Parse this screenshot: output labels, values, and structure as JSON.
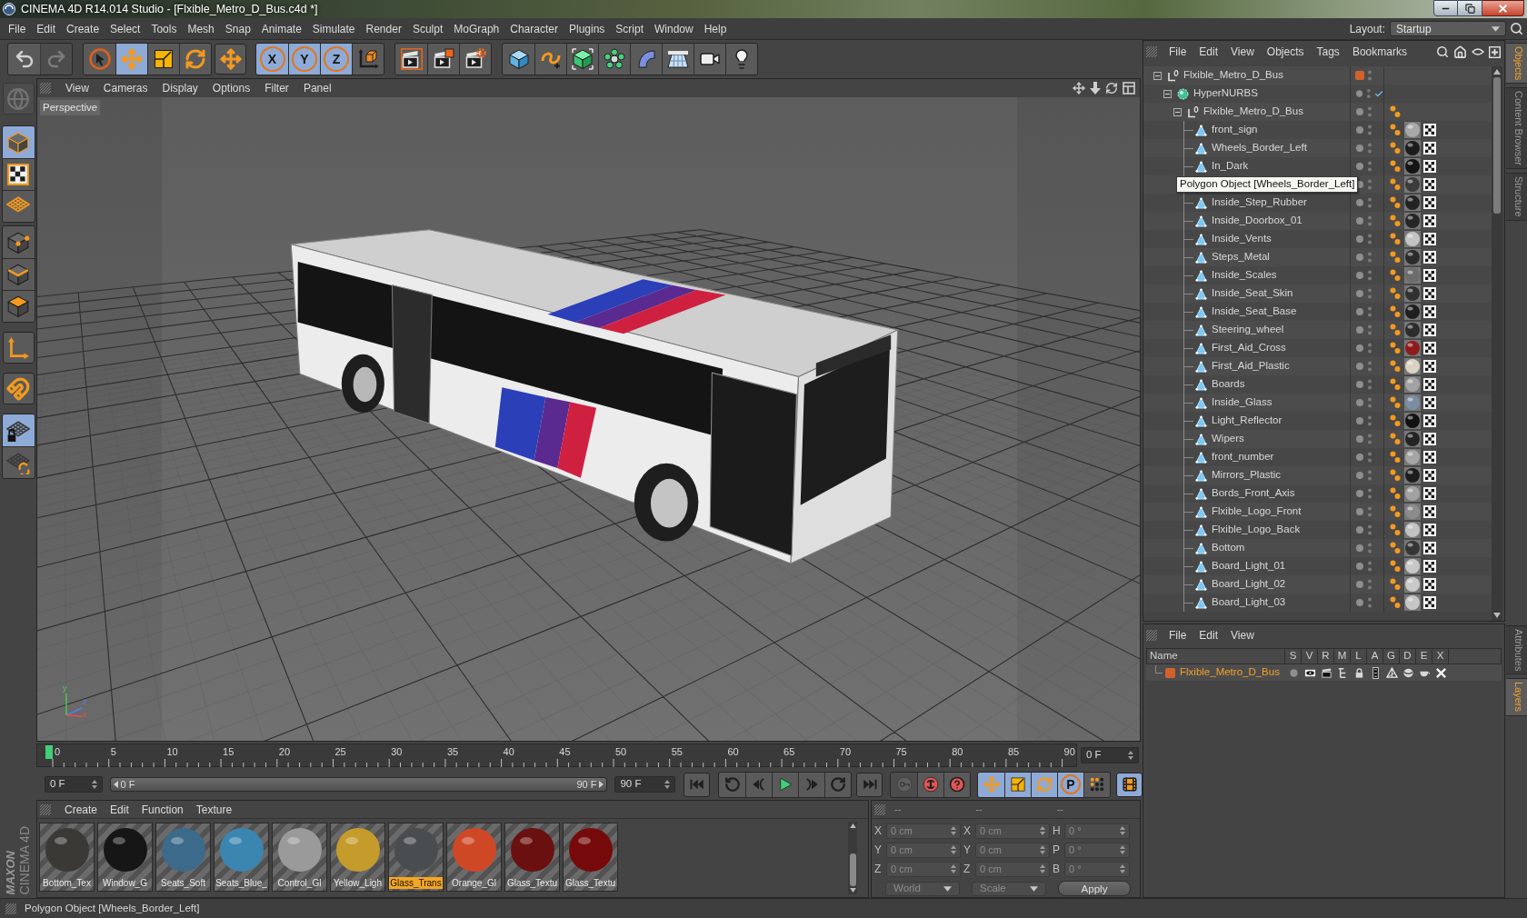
{
  "window": {
    "title": "CINEMA 4D R14.014 Studio - [Flxible_Metro_D_Bus.c4d *]"
  },
  "menu": [
    "File",
    "Edit",
    "Create",
    "Select",
    "Tools",
    "Mesh",
    "Snap",
    "Animate",
    "Simulate",
    "Render",
    "Sculpt",
    "MoGraph",
    "Character",
    "Plugins",
    "Script",
    "Window",
    "Help"
  ],
  "layout": {
    "label": "Layout:",
    "value": "Startup"
  },
  "toolbar": [
    [
      {
        "kind": "undo",
        "selected": false,
        "disabled": false
      },
      {
        "kind": "redo",
        "selected": false,
        "disabled": true
      }
    ],
    [
      {
        "kind": "live-select",
        "selected": false,
        "disabled": false
      },
      {
        "kind": "move",
        "selected": true,
        "disabled": false
      },
      {
        "kind": "scale",
        "selected": false,
        "disabled": false
      },
      {
        "kind": "rotate",
        "selected": false,
        "disabled": false
      }
    ],
    [
      {
        "kind": "recent-tool",
        "selected": false,
        "disabled": false
      }
    ],
    [
      {
        "kind": "axis",
        "label": "X",
        "selected": true,
        "disabled": false
      },
      {
        "kind": "axis",
        "label": "Y",
        "selected": true,
        "disabled": false
      },
      {
        "kind": "axis",
        "label": "Z",
        "selected": true,
        "disabled": false
      },
      {
        "kind": "coord-system",
        "selected": false,
        "disabled": false
      }
    ],
    [
      {
        "kind": "render-view",
        "selected": false,
        "disabled": false
      },
      {
        "kind": "render-picture",
        "selected": false,
        "disabled": false
      },
      {
        "kind": "render-settings",
        "selected": false,
        "disabled": false
      }
    ],
    [
      {
        "kind": "cube",
        "selected": false,
        "disabled": false
      },
      {
        "kind": "spline",
        "selected": false,
        "disabled": false
      },
      {
        "kind": "nurbs",
        "selected": false,
        "disabled": false
      },
      {
        "kind": "cloner",
        "selected": false,
        "disabled": false
      },
      {
        "kind": "deformer",
        "selected": false,
        "disabled": false
      },
      {
        "kind": "floor",
        "selected": false,
        "disabled": false
      },
      {
        "kind": "camera",
        "selected": false,
        "disabled": false
      },
      {
        "kind": "light",
        "selected": false,
        "disabled": false
      }
    ]
  ],
  "modes": [
    [
      {
        "kind": "make-editable",
        "selected": false,
        "disabled": true
      }
    ],
    [
      {
        "kind": "model",
        "selected": true,
        "disabled": false
      },
      {
        "kind": "texture",
        "selected": false,
        "disabled": false
      },
      {
        "kind": "workplane",
        "selected": false,
        "disabled": false
      }
    ],
    [
      {
        "kind": "points",
        "selected": false,
        "disabled": false
      },
      {
        "kind": "edges",
        "selected": false,
        "disabled": false
      },
      {
        "kind": "polygons",
        "selected": false,
        "disabled": false
      }
    ],
    [
      {
        "kind": "axis-mode",
        "selected": false,
        "disabled": false
      }
    ],
    [
      {
        "kind": "snap",
        "selected": false,
        "disabled": false
      }
    ],
    [
      {
        "kind": "lock-workplane",
        "selected": true,
        "disabled": false
      },
      {
        "kind": "planar-workplane",
        "selected": false,
        "disabled": false
      }
    ]
  ],
  "viewport": {
    "menu": [
      "View",
      "Cameras",
      "Display",
      "Options",
      "Filter",
      "Panel"
    ],
    "nav": [
      {
        "kind": "move"
      },
      {
        "kind": "zoom"
      },
      {
        "kind": "rotate"
      },
      {
        "kind": "layout"
      }
    ],
    "label": "Perspective",
    "axis_labels": [
      "y",
      "z",
      "x"
    ]
  },
  "timeline": {
    "ticks": [
      "0",
      "5",
      "10",
      "15",
      "20",
      "25",
      "30",
      "35",
      "40",
      "45",
      "50",
      "55",
      "60",
      "65",
      "70",
      "75",
      "80",
      "85",
      "90"
    ],
    "playhead": {
      "level": 0
    },
    "current_frame": "0 F"
  },
  "playback": {
    "start": "0 F",
    "range": {
      "start": "0 F",
      "end": "90 F",
      "level": 1
    },
    "end": "90 F",
    "controls": [
      [
        {
          "kind": "go-start",
          "selected": false,
          "disabled": false
        }
      ],
      [
        {
          "kind": "prev-key",
          "selected": false,
          "disabled": false
        },
        {
          "kind": "prev-frame",
          "selected": false,
          "disabled": false
        },
        {
          "kind": "play",
          "selected": false,
          "disabled": false
        },
        {
          "kind": "next-frame",
          "selected": false,
          "disabled": false
        },
        {
          "kind": "next-key",
          "selected": false,
          "disabled": false
        }
      ],
      [
        {
          "kind": "go-end",
          "selected": false,
          "disabled": false
        }
      ],
      [
        {
          "kind": "record",
          "selected": false,
          "disabled": true
        },
        {
          "kind": "autokey",
          "selected": false,
          "disabled": false
        },
        {
          "kind": "key-selection",
          "selected": false,
          "disabled": false
        }
      ],
      [
        {
          "kind": "key-position",
          "selected": true,
          "disabled": false
        },
        {
          "kind": "key-scale",
          "selected": true,
          "disabled": false
        },
        {
          "kind": "key-rotation",
          "selected": true,
          "disabled": false
        },
        {
          "kind": "key-param",
          "label": "P",
          "selected": true,
          "disabled": false
        },
        {
          "kind": "key-pla",
          "selected": false,
          "disabled": false
        }
      ],
      [
        {
          "kind": "timeline",
          "selected": true,
          "disabled": false
        }
      ]
    ]
  },
  "materials": {
    "menu": [
      "Create",
      "Edit",
      "Function",
      "Texture"
    ],
    "items": [
      {
        "name": "Bottom_Tex",
        "color": "#3a3936",
        "selected": false
      },
      {
        "name": "Window_G",
        "color": "#161616",
        "selected": false
      },
      {
        "name": "Seats_Soft",
        "color": "#3c6a8a",
        "selected": false
      },
      {
        "name": "Seats_Blue_",
        "color": "#3b86b0",
        "selected": false
      },
      {
        "name": "Control_Gl",
        "color": "#9a9a9a",
        "selected": false
      },
      {
        "name": "Yellow_Ligh",
        "color": "#c59c2c",
        "selected": false
      },
      {
        "name": "Glass_Trans",
        "color": "#4a4d4f",
        "selected": true
      },
      {
        "name": "Orange_Gl",
        "color": "#cf4826",
        "selected": false
      },
      {
        "name": "Glass_Textu",
        "color": "#6b1010",
        "selected": false
      },
      {
        "name": "Glass_Textu",
        "color": "#760a0a",
        "selected": false
      }
    ]
  },
  "coordinates": {
    "headers": [
      "--",
      "--",
      "--"
    ],
    "rows": [
      {
        "position_axis": "X",
        "position": "0 cm",
        "size_axis": "X",
        "size": "0 cm",
        "rotation_axis": "H",
        "rotation": "0 °"
      },
      {
        "position_axis": "Y",
        "position": "0 cm",
        "size_axis": "Y",
        "size": "0 cm",
        "rotation_axis": "P",
        "rotation": "0 °"
      },
      {
        "position_axis": "Z",
        "position": "0 cm",
        "size_axis": "Z",
        "size": "0 cm",
        "rotation_axis": "B",
        "rotation": "0 °"
      }
    ],
    "space": "World",
    "mode": "Scale",
    "apply": "Apply"
  },
  "logo": [
    "MAXON",
    "CINEMA 4D"
  ],
  "objects": {
    "menu": [
      "File",
      "Edit",
      "View",
      "Objects",
      "Tags",
      "Bookmarks"
    ],
    "tooltip": "Polygon Object [Wheels_Border_Left]",
    "tree": [
      {
        "name": "Flxible_Metro_D_Bus",
        "kind": "null",
        "expanded": true,
        "color": "#d2622a",
        "children": [
          {
            "name": "HyperNURBS",
            "kind": "hypernurbs",
            "expanded": true,
            "enabled": true,
            "children": [
              {
                "name": "Flxible_Metro_D_Bus",
                "kind": "null",
                "expanded": true,
                "tags": [
                  {
                    "kind": "phong"
                  }
                ],
                "children": [
                  {
                    "name": "front_sign",
                    "kind": "polygon",
                    "tags": [
                      {
                        "kind": "phong"
                      },
                      {
                        "kind": "material",
                        "color": "#a9a9a9"
                      },
                      {
                        "kind": "uvw"
                      }
                    ]
                  },
                  {
                    "name": "Wheels_Border_Left",
                    "kind": "polygon",
                    "tags": [
                      {
                        "kind": "phong"
                      },
                      {
                        "kind": "material",
                        "color": "#1c1c1c"
                      },
                      {
                        "kind": "uvw"
                      }
                    ]
                  },
                  {
                    "name": "In_Dark",
                    "kind": "polygon",
                    "tags": [
                      {
                        "kind": "phong"
                      },
                      {
                        "kind": "material",
                        "color": "#141414"
                      },
                      {
                        "kind": "uvw"
                      }
                    ]
                  },
                  {
                    "kind": "polygon",
                    "tags": [
                      {
                        "kind": "phong"
                      },
                      {
                        "kind": "material",
                        "color": "#3c3c3c"
                      },
                      {
                        "kind": "uvw"
                      }
                    ]
                  },
                  {
                    "name": "Inside_Step_Rubber",
                    "kind": "polygon",
                    "tags": [
                      {
                        "kind": "phong"
                      },
                      {
                        "kind": "material",
                        "color": "#232323"
                      },
                      {
                        "kind": "uvw"
                      }
                    ]
                  },
                  {
                    "name": "Inside_Doorbox_01",
                    "kind": "polygon",
                    "tags": [
                      {
                        "kind": "phong"
                      },
                      {
                        "kind": "material",
                        "color": "#262626"
                      },
                      {
                        "kind": "uvw"
                      }
                    ]
                  },
                  {
                    "name": "Inside_Vents",
                    "kind": "polygon",
                    "tags": [
                      {
                        "kind": "phong"
                      },
                      {
                        "kind": "material",
                        "color": "#c4c4c4"
                      },
                      {
                        "kind": "uvw"
                      }
                    ]
                  },
                  {
                    "name": "Steps_Metal",
                    "kind": "polygon",
                    "tags": [
                      {
                        "kind": "phong"
                      },
                      {
                        "kind": "material",
                        "color": "#2b2b2b"
                      },
                      {
                        "kind": "uvw"
                      }
                    ]
                  },
                  {
                    "name": "Inside_Scales",
                    "kind": "polygon",
                    "tags": [
                      {
                        "kind": "phong"
                      },
                      {
                        "kind": "material",
                        "color": "#6c6c6c"
                      },
                      {
                        "kind": "uvw"
                      }
                    ]
                  },
                  {
                    "name": "Inside_Seat_Skin",
                    "kind": "polygon",
                    "tags": [
                      {
                        "kind": "phong"
                      },
                      {
                        "kind": "material",
                        "color": "#303030"
                      },
                      {
                        "kind": "uvw"
                      }
                    ]
                  },
                  {
                    "name": "Inside_Seat_Base",
                    "kind": "polygon",
                    "tags": [
                      {
                        "kind": "phong"
                      },
                      {
                        "kind": "material",
                        "color": "#1f1f1f"
                      },
                      {
                        "kind": "uvw"
                      }
                    ]
                  },
                  {
                    "name": "Steering_wheel",
                    "kind": "polygon",
                    "tags": [
                      {
                        "kind": "phong"
                      },
                      {
                        "kind": "material",
                        "color": "#2c2c2c"
                      },
                      {
                        "kind": "uvw"
                      }
                    ]
                  },
                  {
                    "name": "First_Aid_Cross",
                    "kind": "polygon",
                    "tags": [
                      {
                        "kind": "phong"
                      },
                      {
                        "kind": "material",
                        "color": "#8e1b1b"
                      },
                      {
                        "kind": "uvw"
                      }
                    ]
                  },
                  {
                    "name": "First_Aid_Plastic",
                    "kind": "polygon",
                    "tags": [
                      {
                        "kind": "phong"
                      },
                      {
                        "kind": "material",
                        "color": "#d9d3c2"
                      },
                      {
                        "kind": "uvw"
                      }
                    ]
                  },
                  {
                    "name": "Boards",
                    "kind": "polygon",
                    "tags": [
                      {
                        "kind": "phong"
                      },
                      {
                        "kind": "material",
                        "color": "#a3a3a3"
                      },
                      {
                        "kind": "uvw"
                      }
                    ]
                  },
                  {
                    "name": "Inside_Glass",
                    "kind": "polygon",
                    "tags": [
                      {
                        "kind": "phong"
                      },
                      {
                        "kind": "material",
                        "color": "#7b8ea3"
                      },
                      {
                        "kind": "uvw"
                      }
                    ]
                  },
                  {
                    "name": "Light_Reflector",
                    "kind": "polygon",
                    "tags": [
                      {
                        "kind": "phong"
                      },
                      {
                        "kind": "material",
                        "color": "#121212"
                      },
                      {
                        "kind": "uvw"
                      }
                    ]
                  },
                  {
                    "name": "Wipers",
                    "kind": "polygon",
                    "tags": [
                      {
                        "kind": "phong"
                      },
                      {
                        "kind": "material",
                        "color": "#242424"
                      },
                      {
                        "kind": "uvw"
                      }
                    ]
                  },
                  {
                    "name": "front_number",
                    "kind": "polygon",
                    "tags": [
                      {
                        "kind": "phong"
                      },
                      {
                        "kind": "material",
                        "color": "#a5a5a5"
                      },
                      {
                        "kind": "uvw"
                      }
                    ]
                  },
                  {
                    "name": "Mirrors_Plastic",
                    "kind": "polygon",
                    "tags": [
                      {
                        "kind": "phong"
                      },
                      {
                        "kind": "material",
                        "color": "#1d1d1d"
                      },
                      {
                        "kind": "uvw"
                      }
                    ]
                  },
                  {
                    "name": "Bords_Front_Axis",
                    "kind": "polygon",
                    "tags": [
                      {
                        "kind": "phong"
                      },
                      {
                        "kind": "material",
                        "color": "#a2a2a2"
                      },
                      {
                        "kind": "uvw"
                      }
                    ]
                  },
                  {
                    "name": "Flxible_Logo_Front",
                    "kind": "polygon",
                    "tags": [
                      {
                        "kind": "phong"
                      },
                      {
                        "kind": "material",
                        "color": "#8c8c8c"
                      },
                      {
                        "kind": "uvw"
                      }
                    ]
                  },
                  {
                    "name": "Flxible_Logo_Back",
                    "kind": "polygon",
                    "tags": [
                      {
                        "kind": "phong"
                      },
                      {
                        "kind": "material",
                        "color": "#c2c2c2"
                      },
                      {
                        "kind": "uvw"
                      }
                    ]
                  },
                  {
                    "name": "Bottom",
                    "kind": "polygon",
                    "tags": [
                      {
                        "kind": "phong"
                      },
                      {
                        "kind": "material",
                        "color": "#353535"
                      },
                      {
                        "kind": "uvw"
                      }
                    ]
                  },
                  {
                    "name": "Board_Light_01",
                    "kind": "polygon",
                    "tags": [
                      {
                        "kind": "phong"
                      },
                      {
                        "kind": "material",
                        "color": "#c8c8c8"
                      },
                      {
                        "kind": "uvw"
                      }
                    ]
                  },
                  {
                    "name": "Board_Light_02",
                    "kind": "polygon",
                    "tags": [
                      {
                        "kind": "phong"
                      },
                      {
                        "kind": "material",
                        "color": "#c9c9c9"
                      },
                      {
                        "kind": "uvw"
                      }
                    ]
                  },
                  {
                    "name": "Board_Light_03",
                    "kind": "polygon",
                    "tags": [
                      {
                        "kind": "phong"
                      },
                      {
                        "kind": "material",
                        "color": "#c7c7c7"
                      },
                      {
                        "kind": "uvw"
                      }
                    ]
                  }
                ]
              }
            ]
          }
        ]
      }
    ]
  },
  "objects_tabs": [
    {
      "label": "Objects",
      "selected": true
    },
    {
      "label": "Content Browser",
      "selected": false
    },
    {
      "label": "Structure",
      "selected": false
    }
  ],
  "layers": {
    "menu": [
      "File",
      "Edit",
      "View"
    ],
    "columns": [
      "Name",
      "S",
      "V",
      "R",
      "M",
      "L",
      "A",
      "G",
      "D",
      "E",
      "X"
    ],
    "rows": [
      {
        "name": "Flxible_Metro_D_Bus",
        "color": "#d2622a",
        "flags": [
          {
            "kind": "solo",
            "on": false
          },
          {
            "kind": "view",
            "on": true
          },
          {
            "kind": "render",
            "on": true
          },
          {
            "kind": "manager",
            "on": true
          },
          {
            "kind": "lock",
            "on": true
          },
          {
            "kind": "animation",
            "on": true
          },
          {
            "kind": "generators",
            "on": true
          },
          {
            "kind": "deformers",
            "on": true
          },
          {
            "kind": "expressions",
            "on": true
          },
          {
            "kind": "xref",
            "on": true
          }
        ]
      }
    ]
  },
  "attributes_tabs": [
    {
      "label": "Attributes",
      "selected": false
    },
    {
      "label": "Layers",
      "selected": true
    }
  ],
  "status_bar": "Polygon Object [Wheels_Border_Left]"
}
